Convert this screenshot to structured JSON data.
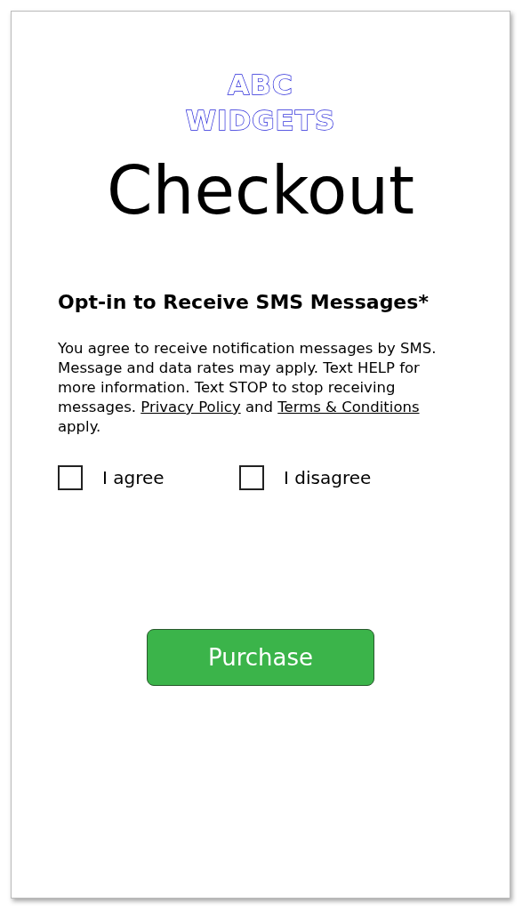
{
  "logo": {
    "lines": [
      "ABC",
      "WIDGETS"
    ]
  },
  "title": "Checkout",
  "section": {
    "heading": "Opt-in to Receive SMS Messages*",
    "paragraph": [
      {
        "kind": "text",
        "text": "You agree to receive notification messages by SMS. Message and data rates may apply. Text HELP for more information. Text STOP to stop receiving messages. "
      },
      {
        "kind": "link",
        "text": "Privacy Policy"
      },
      {
        "kind": "text",
        "text": " and "
      },
      {
        "kind": "link",
        "text": "Terms & Conditions"
      },
      {
        "kind": "text",
        "text": " apply."
      }
    ],
    "options": [
      {
        "label": "I agree",
        "checked": false
      },
      {
        "label": "I disagree",
        "checked": false
      }
    ]
  },
  "button": "Purchase"
}
